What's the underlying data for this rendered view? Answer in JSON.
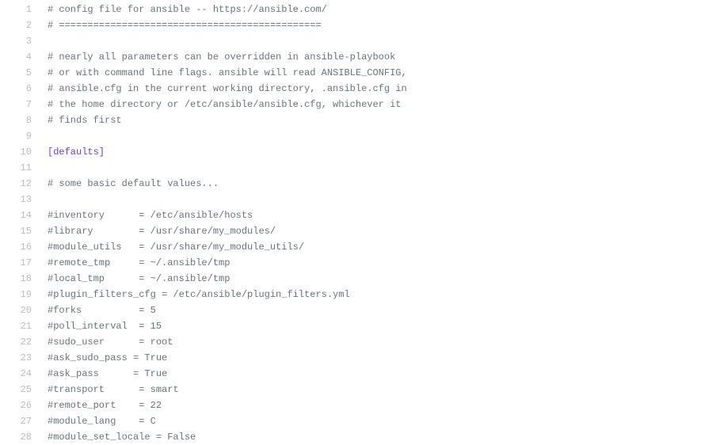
{
  "lines": [
    {
      "n": "1",
      "t": "comment",
      "text": "# config file for ansible -- https://ansible.com/"
    },
    {
      "n": "2",
      "t": "comment",
      "text": "# =============================================="
    },
    {
      "n": "3",
      "t": "blank",
      "text": ""
    },
    {
      "n": "4",
      "t": "comment",
      "text": "# nearly all parameters can be overridden in ansible-playbook"
    },
    {
      "n": "5",
      "t": "comment",
      "text": "# or with command line flags. ansible will read ANSIBLE_CONFIG,"
    },
    {
      "n": "6",
      "t": "comment",
      "text": "# ansible.cfg in the current working directory, .ansible.cfg in"
    },
    {
      "n": "7",
      "t": "comment",
      "text": "# the home directory or /etc/ansible/ansible.cfg, whichever it"
    },
    {
      "n": "8",
      "t": "comment",
      "text": "# finds first"
    },
    {
      "n": "9",
      "t": "blank",
      "text": ""
    },
    {
      "n": "10",
      "t": "section",
      "text": "[defaults]"
    },
    {
      "n": "11",
      "t": "blank",
      "text": ""
    },
    {
      "n": "12",
      "t": "comment",
      "text": "# some basic default values..."
    },
    {
      "n": "13",
      "t": "blank",
      "text": ""
    },
    {
      "n": "14",
      "t": "comment",
      "text": "#inventory      = /etc/ansible/hosts"
    },
    {
      "n": "15",
      "t": "comment",
      "text": "#library        = /usr/share/my_modules/"
    },
    {
      "n": "16",
      "t": "comment",
      "text": "#module_utils   = /usr/share/my_module_utils/"
    },
    {
      "n": "17",
      "t": "comment",
      "text": "#remote_tmp     = ~/.ansible/tmp"
    },
    {
      "n": "18",
      "t": "comment",
      "text": "#local_tmp      = ~/.ansible/tmp"
    },
    {
      "n": "19",
      "t": "comment",
      "text": "#plugin_filters_cfg = /etc/ansible/plugin_filters.yml"
    },
    {
      "n": "20",
      "t": "comment",
      "text": "#forks          = 5"
    },
    {
      "n": "21",
      "t": "comment",
      "text": "#poll_interval  = 15"
    },
    {
      "n": "22",
      "t": "comment",
      "text": "#sudo_user      = root"
    },
    {
      "n": "23",
      "t": "comment",
      "text": "#ask_sudo_pass = True"
    },
    {
      "n": "24",
      "t": "comment",
      "text": "#ask_pass      = True"
    },
    {
      "n": "25",
      "t": "comment",
      "text": "#transport      = smart"
    },
    {
      "n": "26",
      "t": "comment",
      "text": "#remote_port    = 22"
    },
    {
      "n": "27",
      "t": "comment",
      "text": "#module_lang    = C"
    },
    {
      "n": "28",
      "t": "comment",
      "text": "#module_set_locale = False"
    }
  ]
}
